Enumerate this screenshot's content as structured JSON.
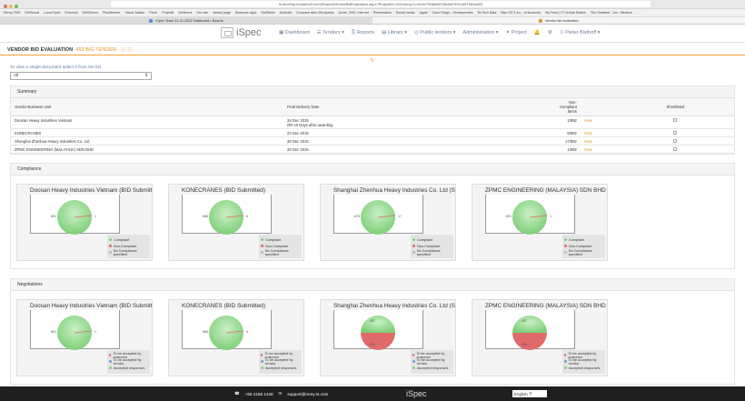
{
  "browser": {
    "url": "ls-develop.tendamo3.com/Shared/VendorBidEvaluation.aspx?ProjectID=4024&Imp=LnD0b/7658b08748d6b7931c697562a683",
    "bookmarks": [
      "Remy CMS",
      "DMStocal",
      "Local iSpec",
      "Emerical",
      "DMSDemo",
      "PinoMeneer",
      "Visual Station",
      "Finch",
      "Project8",
      "Wotlmms",
      "Dev site",
      "default page",
      "Business apps",
      "DMSlinks",
      "Dentrals",
      "Compare sites Wordpress",
      "Azure, DNS, Internet",
      "Presentation",
      "Social media",
      "Apple",
      "Carlo Ridge... Monteprentes",
      "DuTech Data",
      "Mac OS X ko... nt shortcuts",
      "My Feed | IT Central Station",
      "The Greatest ...lon - Medium"
    ],
    "tabs": [
      {
        "label": "iSpec Team 21-01-2022 Taskboard • Boards"
      },
      {
        "label": "Vendor bid evaluation"
      }
    ]
  },
  "nav": {
    "dashboard": "Dashboard",
    "tenders": "Tenders",
    "reports": "Reports",
    "library": "Library",
    "public_tenders": "Public tenders",
    "administration": "Administration",
    "project": "Project",
    "user": "Pieter Bisthoff"
  },
  "logo_text": "iSpec",
  "page": {
    "title": "VENDOR BID EVALUATION",
    "project": "453 BIG TENDER",
    "hint": "To view a single document select it from the list",
    "select_value": "All"
  },
  "summary": {
    "heading": "Summary",
    "columns": [
      "Vendor Business Unit",
      "Final Delivery Date",
      "Non-Compliant Items",
      "Shortlisted"
    ],
    "rows": [
      {
        "vendor": "Doosan Heavy Industries Vietnam",
        "date": "28 Dec 2015",
        "date2": "OR 16 Days after awarding",
        "noncompliant": "1/892",
        "view": "View"
      },
      {
        "vendor": "KONECRANES",
        "date": "23 Dec 2015",
        "date2": "",
        "noncompliant": "6/892",
        "view": "View"
      },
      {
        "vendor": "Shanghai Zhenhua Heavy Industries Co. Ltd",
        "date": "28 Dec 2015",
        "date2": "",
        "noncompliant": "17/892",
        "view": "View"
      },
      {
        "vendor": "ZPMC ENGINEERING (MALAYSIA) SDN BHD",
        "date": "28 Dec 2015",
        "date2": "",
        "noncompliant": "1/892",
        "view": "View"
      }
    ]
  },
  "compliance": {
    "heading": "Compliance",
    "legend": [
      "Compliant",
      "Non-Compliant",
      "No Compliance specified"
    ],
    "cards": [
      {
        "title": "Doosan Heavy Industries Vietnam (BID Submitted)",
        "left": "891",
        "right": "1"
      },
      {
        "title": "KONECRANES (BID Submitted)",
        "left": "886",
        "right": "6"
      },
      {
        "title": "Shanghai Zhenhua Heavy Industries Co. Ltd (Submitted)",
        "left": "875",
        "right": "17"
      },
      {
        "title": "ZPMC ENGINEERING (MALAYSIA) SDN BHD",
        "left": "891",
        "right": "1"
      }
    ]
  },
  "negotiations": {
    "heading": "Negotiations",
    "legend": [
      "To be accepted by customer",
      "To be accepted by vendor",
      "Accepted responses"
    ],
    "cards": [
      {
        "title": "Doosan Heavy Industries Vietnam (BID Submitted)",
        "left": "891",
        "right": "1"
      },
      {
        "title": "KONECRANES (BID Submitted)",
        "left": "886",
        "right": "6"
      },
      {
        "title": "Shanghai Zhenhua Heavy Industries Co. Ltd (Submitted)",
        "left": "457",
        "right": "435"
      },
      {
        "title": "ZPMC ENGINEERING (MALAYSIA) SDN BHD",
        "left": "457",
        "right": "435"
      }
    ]
  },
  "colors": {
    "accent": "#e8952a",
    "green": "#7fcf7a",
    "red": "#e06a6a"
  },
  "footer": {
    "phone": "+65 3158 1448",
    "email": "support@remy-is.com",
    "logo": "iSpec",
    "language": "English"
  }
}
